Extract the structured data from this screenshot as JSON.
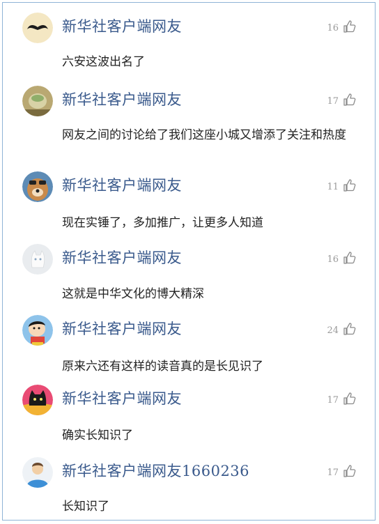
{
  "comments": [
    {
      "user": "新华社客户端网友",
      "likes": "16",
      "text": "六安这波出名了",
      "avatar": "mustache-avatar"
    },
    {
      "user": "新华社客户端网友",
      "likes": "17",
      "text": "网友之间的讨论给了我们这座小城又增添了关注和热度",
      "avatar": "food-avatar"
    },
    {
      "user": "新华社客户端网友",
      "likes": "11",
      "text": "现在实锤了，多加推广，让更多人知道",
      "avatar": "dog-avatar"
    },
    {
      "user": "新华社客户端网友",
      "likes": "16",
      "text": "这就是中华文化的博大精深",
      "avatar": "white-cat-avatar"
    },
    {
      "user": "新华社客户端网友",
      "likes": "24",
      "text": "原来六还有这样的读音真的是长见识了",
      "avatar": "cartoon-boy-avatar"
    },
    {
      "user": "新华社客户端网友",
      "likes": "17",
      "text": "确实长知识了",
      "avatar": "black-cat-avatar"
    },
    {
      "user": "新华社客户端网友1660236",
      "likes": "17",
      "text": "长知识了",
      "avatar": "default-person-avatar"
    }
  ],
  "colors": {
    "username": "#3a5a8c",
    "border": "#8fb4d6",
    "like": "#9a9a9a"
  }
}
